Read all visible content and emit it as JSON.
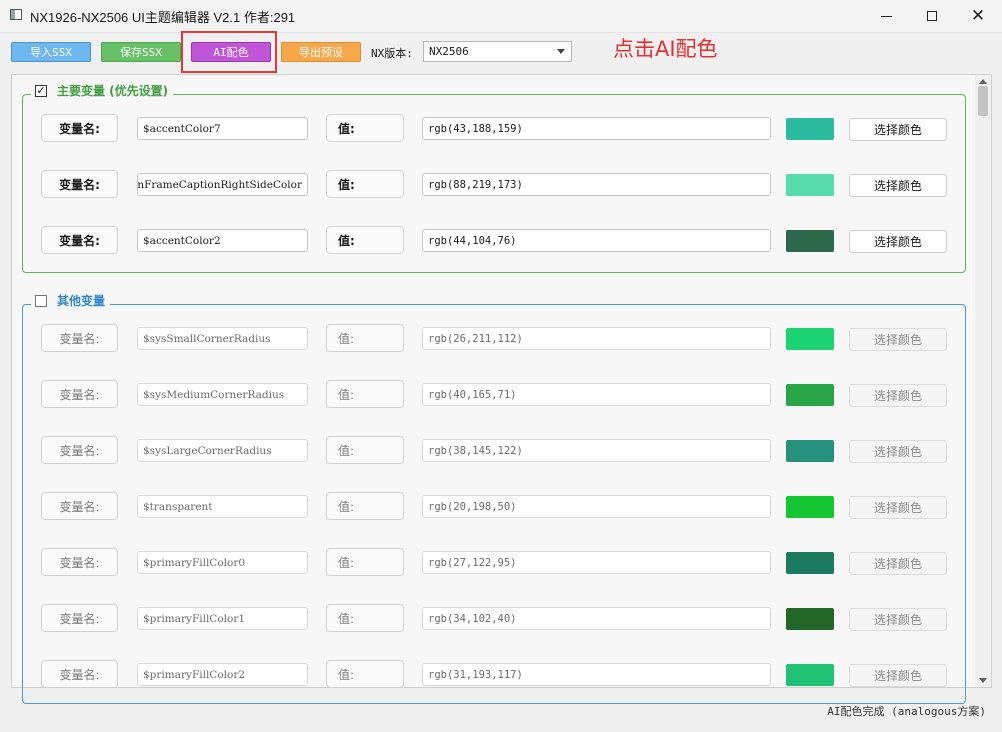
{
  "window": {
    "title": "NX1926-NX2506 UI主题编辑器 V2.1 作者:291",
    "close_glyph": "✕"
  },
  "toolbar": {
    "import_label": "导入SSX",
    "save_label": "保存SSX",
    "ai_label": "AI配色",
    "export_label": "导出预设",
    "version_label": "NX版本:",
    "version_value": "NX2506"
  },
  "annotation": "点击AI配色",
  "colors": {
    "import": "#6fb7ef",
    "save": "#67c267",
    "ai": "#c155d8",
    "export": "#f5a84a",
    "main_group": "#5cb85c",
    "other_group": "#4a9ad8",
    "highlight": "#e03a3a"
  },
  "labels": {
    "name": "变量名:",
    "value": "值:",
    "pick": "选择颜色"
  },
  "main_group": {
    "title": "主要变量 (优先设置)",
    "checked": true,
    "check_glyph": "✓",
    "rows": [
      {
        "name": "$accentColor7",
        "value": "rgb(43,188,159)",
        "color": "#2bbc9f"
      },
      {
        "name": "nFrameCaptionRightSideColor",
        "value": "rgb(88,219,173)",
        "color": "#58dbad"
      },
      {
        "name": "$accentColor2",
        "value": "rgb(44,104,76)",
        "color": "#2c684c"
      }
    ]
  },
  "other_group": {
    "title": "其他变量",
    "checked": false,
    "rows": [
      {
        "name": "$sysSmallCornerRadius",
        "value": "rgb(26,211,112)",
        "color": "#1ad370"
      },
      {
        "name": "$sysMediumCornerRadius",
        "value": "rgb(40,165,71)",
        "color": "#28a547"
      },
      {
        "name": "$sysLargeCornerRadius",
        "value": "rgb(38,145,122)",
        "color": "#26917a"
      },
      {
        "name": "$transparent",
        "value": "rgb(20,198,50)",
        "color": "#14c632"
      },
      {
        "name": "$primaryFillColor0",
        "value": "rgb(27,122,95)",
        "color": "#1b7a5f"
      },
      {
        "name": "$primaryFillColor1",
        "value": "rgb(34,102,40)",
        "color": "#226628"
      },
      {
        "name": "$primaryFillColor2",
        "value": "rgb(31,193,117)",
        "color": "#1fc175"
      }
    ]
  },
  "status_text": "AI配色完成 (analogous方案)"
}
